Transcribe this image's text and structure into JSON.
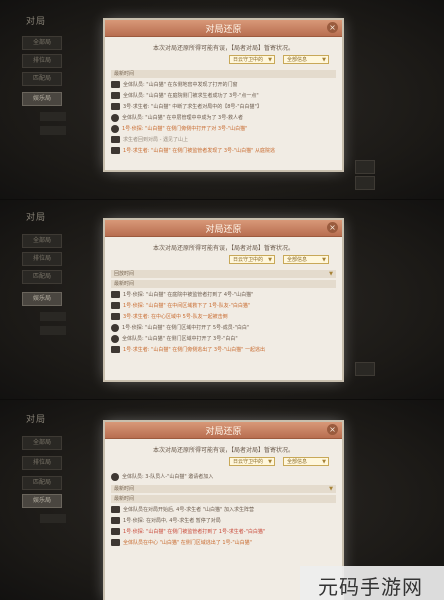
{
  "panels": [
    {
      "dialog": {
        "title": "对局还原",
        "note": "本次对局还原所得可能有误，【局者对局】暂寄状况。",
        "drop_left": "日云守卫中的",
        "drop_right": "全部信息",
        "section": "最新时间",
        "rows": [
          "全体队员: \"山白猫\" 在东侧地窖中发现了打开的门窗",
          "全体队员: \"山白猫\" 在庭院侧门被求生者成功了 3号-\"点一点\"",
          "3号·求生者: \"山白猫\" 中断了求生者对局中的【8号-\"白白猫\"】",
          "全体队员: \"山白猫\" 在中层管理中中成为了 3号-救人者",
          "1号·侦探: \"山白猫\" 在侧门旁侧中打开了对 3号-\"山白猫\"",
          "求生者回到对局 - 遇见了山上",
          "1号·求生者: \"山白猫\" 在侧门被监管者发现了 3号-\"山白猫\" 从庭院逃"
        ]
      },
      "sidebar": [
        "全部局",
        "排位局",
        "匹配局",
        "娱乐局"
      ],
      "sidebar_title": "对局"
    },
    {
      "dialog": {
        "title": "对局还原",
        "note": "本次对局还原所得可能有误，【局者对局】暂寄状况。",
        "drop_left": "日云守卫中的",
        "drop_right": "全部信息",
        "section": "回放时间",
        "section2": "最新时间",
        "rows": [
          "1号·侦探: \"山白猫\" 在庭院中被监管者打到了 4号-\"山白猫\"",
          "1号·侦探: \"山白猫\" 在中间区域救下了 1号-队友-\"白白猫\"",
          "3号·求生者: 在中心区域中 5号-队友一起被击倒",
          "1号·侦探: \"山白猫\" 在侧门区域中打开了 5号-成员-\"白白\"",
          "全体队员: \"山白猫\" 在侧门区域中打开了 3号-\"白白\"",
          "1号·求生者: \"山白猫\" 在侧门旁侧逃出了 3号-\"山白猫\" 一起逃出"
        ]
      },
      "sidebar": [
        "全部局",
        "排位局",
        "匹配局",
        "娱乐局"
      ],
      "sidebar_title": "对局"
    },
    {
      "dialog": {
        "title": "对局还原",
        "note": "本次对局还原所得可能有误，【局者对局】暂寄状况。",
        "drop_left": "日云守卫中的",
        "drop_right": "全部信息",
        "top_row": "全体队员: 3-队员人-\"山白猫\" 邀请者加入",
        "section": "最新时间",
        "section2": "最新时间",
        "rows": [
          "全体队员在对局开始后, 4号-求生者 \"山白猫\" 加入求生阵营",
          "1号·侦探: 在对局中, 4号-求生者 暂停了对局",
          "1号·侦探: \"山白猫\" 在侧门被监管者打到了 1号-求生者-\"白白猫\"",
          "全体队员在中心 \"山白猫\" 在侧门区域逃出了 1号-\"山白猫\""
        ]
      },
      "sidebar": [
        "全部局",
        "排位局",
        "匹配局",
        "娱乐局"
      ],
      "sidebar_title": "对局"
    }
  ],
  "watermark": {
    "text": "元码手游网"
  }
}
